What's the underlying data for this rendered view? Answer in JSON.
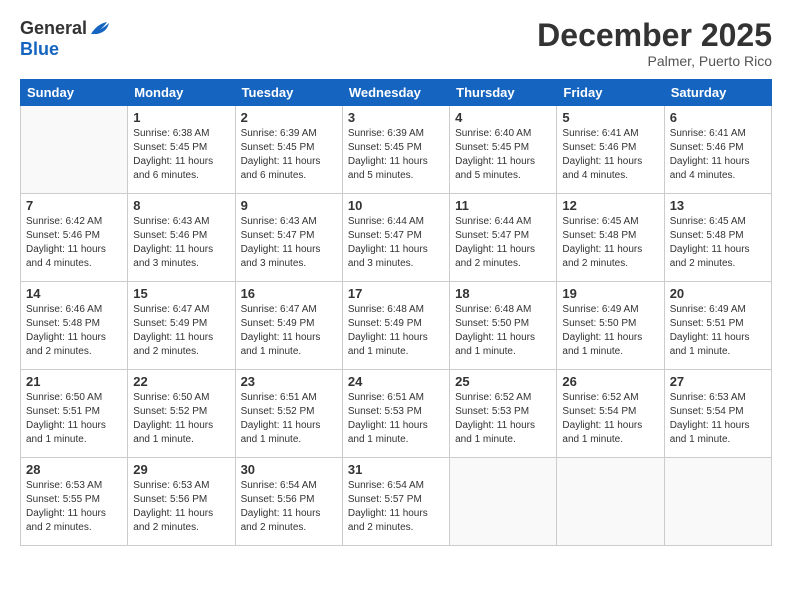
{
  "header": {
    "logo_general": "General",
    "logo_blue": "Blue",
    "month_title": "December 2025",
    "location": "Palmer, Puerto Rico"
  },
  "days_of_week": [
    "Sunday",
    "Monday",
    "Tuesday",
    "Wednesday",
    "Thursday",
    "Friday",
    "Saturday"
  ],
  "weeks": [
    [
      {
        "day": "",
        "sunrise": "",
        "sunset": "",
        "daylight": ""
      },
      {
        "day": "1",
        "sunrise": "Sunrise: 6:38 AM",
        "sunset": "Sunset: 5:45 PM",
        "daylight": "Daylight: 11 hours and 6 minutes."
      },
      {
        "day": "2",
        "sunrise": "Sunrise: 6:39 AM",
        "sunset": "Sunset: 5:45 PM",
        "daylight": "Daylight: 11 hours and 6 minutes."
      },
      {
        "day": "3",
        "sunrise": "Sunrise: 6:39 AM",
        "sunset": "Sunset: 5:45 PM",
        "daylight": "Daylight: 11 hours and 5 minutes."
      },
      {
        "day": "4",
        "sunrise": "Sunrise: 6:40 AM",
        "sunset": "Sunset: 5:45 PM",
        "daylight": "Daylight: 11 hours and 5 minutes."
      },
      {
        "day": "5",
        "sunrise": "Sunrise: 6:41 AM",
        "sunset": "Sunset: 5:46 PM",
        "daylight": "Daylight: 11 hours and 4 minutes."
      },
      {
        "day": "6",
        "sunrise": "Sunrise: 6:41 AM",
        "sunset": "Sunset: 5:46 PM",
        "daylight": "Daylight: 11 hours and 4 minutes."
      }
    ],
    [
      {
        "day": "7",
        "sunrise": "Sunrise: 6:42 AM",
        "sunset": "Sunset: 5:46 PM",
        "daylight": "Daylight: 11 hours and 4 minutes."
      },
      {
        "day": "8",
        "sunrise": "Sunrise: 6:43 AM",
        "sunset": "Sunset: 5:46 PM",
        "daylight": "Daylight: 11 hours and 3 minutes."
      },
      {
        "day": "9",
        "sunrise": "Sunrise: 6:43 AM",
        "sunset": "Sunset: 5:47 PM",
        "daylight": "Daylight: 11 hours and 3 minutes."
      },
      {
        "day": "10",
        "sunrise": "Sunrise: 6:44 AM",
        "sunset": "Sunset: 5:47 PM",
        "daylight": "Daylight: 11 hours and 3 minutes."
      },
      {
        "day": "11",
        "sunrise": "Sunrise: 6:44 AM",
        "sunset": "Sunset: 5:47 PM",
        "daylight": "Daylight: 11 hours and 2 minutes."
      },
      {
        "day": "12",
        "sunrise": "Sunrise: 6:45 AM",
        "sunset": "Sunset: 5:48 PM",
        "daylight": "Daylight: 11 hours and 2 minutes."
      },
      {
        "day": "13",
        "sunrise": "Sunrise: 6:45 AM",
        "sunset": "Sunset: 5:48 PM",
        "daylight": "Daylight: 11 hours and 2 minutes."
      }
    ],
    [
      {
        "day": "14",
        "sunrise": "Sunrise: 6:46 AM",
        "sunset": "Sunset: 5:48 PM",
        "daylight": "Daylight: 11 hours and 2 minutes."
      },
      {
        "day": "15",
        "sunrise": "Sunrise: 6:47 AM",
        "sunset": "Sunset: 5:49 PM",
        "daylight": "Daylight: 11 hours and 2 minutes."
      },
      {
        "day": "16",
        "sunrise": "Sunrise: 6:47 AM",
        "sunset": "Sunset: 5:49 PM",
        "daylight": "Daylight: 11 hours and 1 minute."
      },
      {
        "day": "17",
        "sunrise": "Sunrise: 6:48 AM",
        "sunset": "Sunset: 5:49 PM",
        "daylight": "Daylight: 11 hours and 1 minute."
      },
      {
        "day": "18",
        "sunrise": "Sunrise: 6:48 AM",
        "sunset": "Sunset: 5:50 PM",
        "daylight": "Daylight: 11 hours and 1 minute."
      },
      {
        "day": "19",
        "sunrise": "Sunrise: 6:49 AM",
        "sunset": "Sunset: 5:50 PM",
        "daylight": "Daylight: 11 hours and 1 minute."
      },
      {
        "day": "20",
        "sunrise": "Sunrise: 6:49 AM",
        "sunset": "Sunset: 5:51 PM",
        "daylight": "Daylight: 11 hours and 1 minute."
      }
    ],
    [
      {
        "day": "21",
        "sunrise": "Sunrise: 6:50 AM",
        "sunset": "Sunset: 5:51 PM",
        "daylight": "Daylight: 11 hours and 1 minute."
      },
      {
        "day": "22",
        "sunrise": "Sunrise: 6:50 AM",
        "sunset": "Sunset: 5:52 PM",
        "daylight": "Daylight: 11 hours and 1 minute."
      },
      {
        "day": "23",
        "sunrise": "Sunrise: 6:51 AM",
        "sunset": "Sunset: 5:52 PM",
        "daylight": "Daylight: 11 hours and 1 minute."
      },
      {
        "day": "24",
        "sunrise": "Sunrise: 6:51 AM",
        "sunset": "Sunset: 5:53 PM",
        "daylight": "Daylight: 11 hours and 1 minute."
      },
      {
        "day": "25",
        "sunrise": "Sunrise: 6:52 AM",
        "sunset": "Sunset: 5:53 PM",
        "daylight": "Daylight: 11 hours and 1 minute."
      },
      {
        "day": "26",
        "sunrise": "Sunrise: 6:52 AM",
        "sunset": "Sunset: 5:54 PM",
        "daylight": "Daylight: 11 hours and 1 minute."
      },
      {
        "day": "27",
        "sunrise": "Sunrise: 6:53 AM",
        "sunset": "Sunset: 5:54 PM",
        "daylight": "Daylight: 11 hours and 1 minute."
      }
    ],
    [
      {
        "day": "28",
        "sunrise": "Sunrise: 6:53 AM",
        "sunset": "Sunset: 5:55 PM",
        "daylight": "Daylight: 11 hours and 2 minutes."
      },
      {
        "day": "29",
        "sunrise": "Sunrise: 6:53 AM",
        "sunset": "Sunset: 5:56 PM",
        "daylight": "Daylight: 11 hours and 2 minutes."
      },
      {
        "day": "30",
        "sunrise": "Sunrise: 6:54 AM",
        "sunset": "Sunset: 5:56 PM",
        "daylight": "Daylight: 11 hours and 2 minutes."
      },
      {
        "day": "31",
        "sunrise": "Sunrise: 6:54 AM",
        "sunset": "Sunset: 5:57 PM",
        "daylight": "Daylight: 11 hours and 2 minutes."
      },
      {
        "day": "",
        "sunrise": "",
        "sunset": "",
        "daylight": ""
      },
      {
        "day": "",
        "sunrise": "",
        "sunset": "",
        "daylight": ""
      },
      {
        "day": "",
        "sunrise": "",
        "sunset": "",
        "daylight": ""
      }
    ]
  ]
}
